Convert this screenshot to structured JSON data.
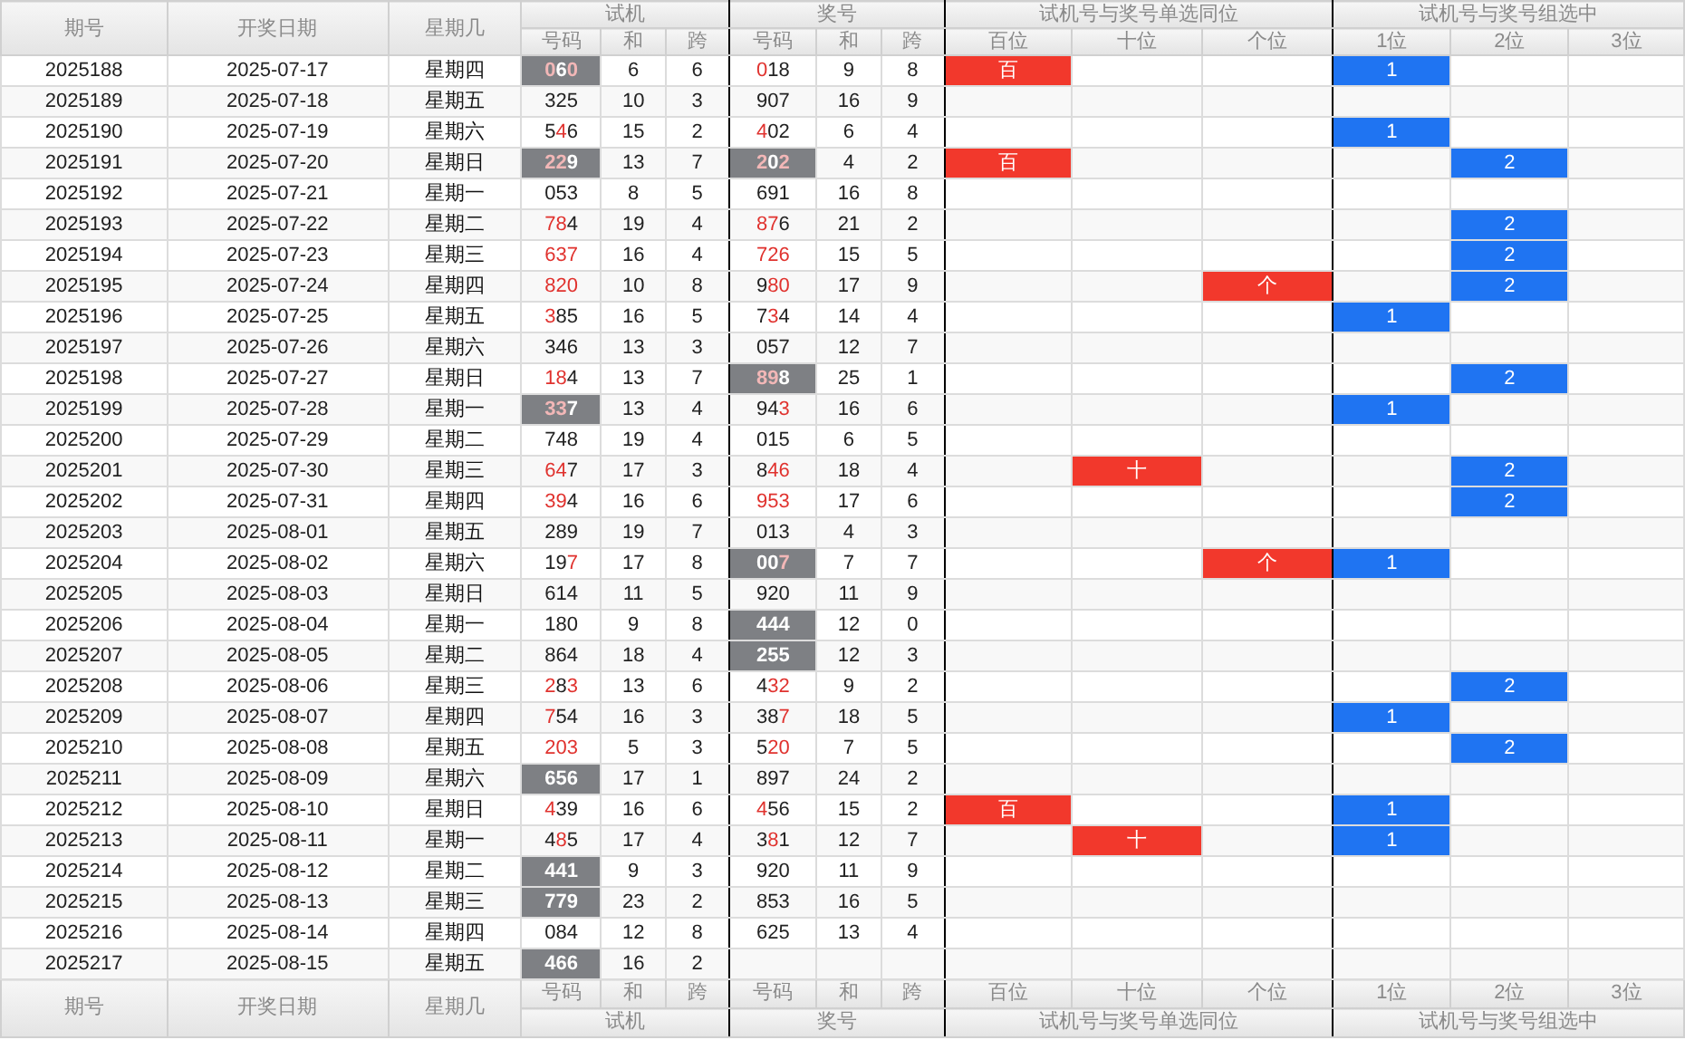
{
  "header": {
    "columns": [
      "期号",
      "开奖日期",
      "星期几"
    ],
    "groups": [
      {
        "title": "试机",
        "sub": [
          "号码",
          "和",
          "跨"
        ]
      },
      {
        "title": "奖号",
        "sub": [
          "号码",
          "和",
          "跨"
        ]
      },
      {
        "title": "试机号与奖号单选同位",
        "sub": [
          "百位",
          "十位",
          "个位"
        ]
      },
      {
        "title": "试机号与奖号组选中",
        "sub": [
          "1位",
          "2位",
          "3位"
        ]
      }
    ]
  },
  "rows": [
    {
      "period": "2025188",
      "date": "2025-07-17",
      "weekday": "星期四",
      "trial": {
        "number": "060",
        "red": [
          true,
          false,
          true
        ],
        "boxed": true
      },
      "trial_sum": "6",
      "trial_span": "6",
      "prize": {
        "number": "018",
        "red": [
          true,
          false,
          false
        ],
        "boxed": false
      },
      "prize_sum": "9",
      "prize_span": "8",
      "single_hit": {
        "hundreds": "百"
      },
      "group_hit": {
        "first": "1"
      }
    },
    {
      "period": "2025189",
      "date": "2025-07-18",
      "weekday": "星期五",
      "trial": {
        "number": "325",
        "red": [
          false,
          false,
          false
        ],
        "boxed": false
      },
      "trial_sum": "10",
      "trial_span": "3",
      "prize": {
        "number": "907",
        "red": [
          false,
          false,
          false
        ],
        "boxed": false
      },
      "prize_sum": "16",
      "prize_span": "9"
    },
    {
      "period": "2025190",
      "date": "2025-07-19",
      "weekday": "星期六",
      "trial": {
        "number": "546",
        "red": [
          false,
          true,
          false
        ],
        "boxed": false
      },
      "trial_sum": "15",
      "trial_span": "2",
      "prize": {
        "number": "402",
        "red": [
          true,
          false,
          false
        ],
        "boxed": false
      },
      "prize_sum": "6",
      "prize_span": "4",
      "group_hit": {
        "first": "1"
      }
    },
    {
      "period": "2025191",
      "date": "2025-07-20",
      "weekday": "星期日",
      "trial": {
        "number": "229",
        "red": [
          true,
          true,
          false
        ],
        "boxed": true
      },
      "trial_sum": "13",
      "trial_span": "7",
      "prize": {
        "number": "202",
        "red": [
          true,
          false,
          true
        ],
        "boxed": true
      },
      "prize_sum": "4",
      "prize_span": "2",
      "single_hit": {
        "hundreds": "百"
      },
      "group_hit": {
        "second": "2"
      }
    },
    {
      "period": "2025192",
      "date": "2025-07-21",
      "weekday": "星期一",
      "trial": {
        "number": "053",
        "red": [
          false,
          false,
          false
        ],
        "boxed": false
      },
      "trial_sum": "8",
      "trial_span": "5",
      "prize": {
        "number": "691",
        "red": [
          false,
          false,
          false
        ],
        "boxed": false
      },
      "prize_sum": "16",
      "prize_span": "8"
    },
    {
      "period": "2025193",
      "date": "2025-07-22",
      "weekday": "星期二",
      "trial": {
        "number": "784",
        "red": [
          true,
          true,
          false
        ],
        "boxed": false
      },
      "trial_sum": "19",
      "trial_span": "4",
      "prize": {
        "number": "876",
        "red": [
          true,
          true,
          false
        ],
        "boxed": false
      },
      "prize_sum": "21",
      "prize_span": "2",
      "group_hit": {
        "second": "2"
      }
    },
    {
      "period": "2025194",
      "date": "2025-07-23",
      "weekday": "星期三",
      "trial": {
        "number": "637",
        "red": [
          true,
          true,
          true
        ],
        "boxed": false
      },
      "trial_sum": "16",
      "trial_span": "4",
      "prize": {
        "number": "726",
        "red": [
          true,
          true,
          true
        ],
        "boxed": false
      },
      "prize_sum": "15",
      "prize_span": "5",
      "group_hit": {
        "second": "2"
      }
    },
    {
      "period": "2025195",
      "date": "2025-07-24",
      "weekday": "星期四",
      "trial": {
        "number": "820",
        "red": [
          true,
          true,
          true
        ],
        "boxed": false
      },
      "trial_sum": "10",
      "trial_span": "8",
      "prize": {
        "number": "980",
        "red": [
          false,
          true,
          true
        ],
        "boxed": false
      },
      "prize_sum": "17",
      "prize_span": "9",
      "single_hit": {
        "units": "个"
      },
      "group_hit": {
        "second": "2"
      }
    },
    {
      "period": "2025196",
      "date": "2025-07-25",
      "weekday": "星期五",
      "trial": {
        "number": "385",
        "red": [
          true,
          false,
          false
        ],
        "boxed": false
      },
      "trial_sum": "16",
      "trial_span": "5",
      "prize": {
        "number": "734",
        "red": [
          false,
          true,
          false
        ],
        "boxed": false
      },
      "prize_sum": "14",
      "prize_span": "4",
      "group_hit": {
        "first": "1"
      }
    },
    {
      "period": "2025197",
      "date": "2025-07-26",
      "weekday": "星期六",
      "trial": {
        "number": "346",
        "red": [
          false,
          false,
          false
        ],
        "boxed": false
      },
      "trial_sum": "13",
      "trial_span": "3",
      "prize": {
        "number": "057",
        "red": [
          false,
          false,
          false
        ],
        "boxed": false
      },
      "prize_sum": "12",
      "prize_span": "7"
    },
    {
      "period": "2025198",
      "date": "2025-07-27",
      "weekday": "星期日",
      "trial": {
        "number": "184",
        "red": [
          true,
          true,
          false
        ],
        "boxed": false
      },
      "trial_sum": "13",
      "trial_span": "7",
      "prize": {
        "number": "898",
        "red": [
          true,
          true,
          false
        ],
        "boxed": true
      },
      "prize_sum": "25",
      "prize_span": "1",
      "group_hit": {
        "second": "2"
      }
    },
    {
      "period": "2025199",
      "date": "2025-07-28",
      "weekday": "星期一",
      "trial": {
        "number": "337",
        "red": [
          true,
          true,
          false
        ],
        "boxed": true
      },
      "trial_sum": "13",
      "trial_span": "4",
      "prize": {
        "number": "943",
        "red": [
          false,
          false,
          true
        ],
        "boxed": false
      },
      "prize_sum": "16",
      "prize_span": "6",
      "group_hit": {
        "first": "1"
      }
    },
    {
      "period": "2025200",
      "date": "2025-07-29",
      "weekday": "星期二",
      "trial": {
        "number": "748",
        "red": [
          false,
          false,
          false
        ],
        "boxed": false
      },
      "trial_sum": "19",
      "trial_span": "4",
      "prize": {
        "number": "015",
        "red": [
          false,
          false,
          false
        ],
        "boxed": false
      },
      "prize_sum": "6",
      "prize_span": "5"
    },
    {
      "period": "2025201",
      "date": "2025-07-30",
      "weekday": "星期三",
      "trial": {
        "number": "647",
        "red": [
          true,
          true,
          false
        ],
        "boxed": false
      },
      "trial_sum": "17",
      "trial_span": "3",
      "prize": {
        "number": "846",
        "red": [
          false,
          true,
          true
        ],
        "boxed": false
      },
      "prize_sum": "18",
      "prize_span": "4",
      "single_hit": {
        "tens": "十"
      },
      "group_hit": {
        "second": "2"
      }
    },
    {
      "period": "2025202",
      "date": "2025-07-31",
      "weekday": "星期四",
      "trial": {
        "number": "394",
        "red": [
          true,
          true,
          false
        ],
        "boxed": false
      },
      "trial_sum": "16",
      "trial_span": "6",
      "prize": {
        "number": "953",
        "red": [
          true,
          true,
          true
        ],
        "boxed": false
      },
      "prize_sum": "17",
      "prize_span": "6",
      "group_hit": {
        "second": "2"
      }
    },
    {
      "period": "2025203",
      "date": "2025-08-01",
      "weekday": "星期五",
      "trial": {
        "number": "289",
        "red": [
          false,
          false,
          false
        ],
        "boxed": false
      },
      "trial_sum": "19",
      "trial_span": "7",
      "prize": {
        "number": "013",
        "red": [
          false,
          false,
          false
        ],
        "boxed": false
      },
      "prize_sum": "4",
      "prize_span": "3"
    },
    {
      "period": "2025204",
      "date": "2025-08-02",
      "weekday": "星期六",
      "trial": {
        "number": "197",
        "red": [
          false,
          false,
          true
        ],
        "boxed": false
      },
      "trial_sum": "17",
      "trial_span": "8",
      "prize": {
        "number": "007",
        "red": [
          false,
          false,
          true
        ],
        "boxed": true
      },
      "prize_sum": "7",
      "prize_span": "7",
      "single_hit": {
        "units": "个"
      },
      "group_hit": {
        "first": "1"
      }
    },
    {
      "period": "2025205",
      "date": "2025-08-03",
      "weekday": "星期日",
      "trial": {
        "number": "614",
        "red": [
          false,
          false,
          false
        ],
        "boxed": false
      },
      "trial_sum": "11",
      "trial_span": "5",
      "prize": {
        "number": "920",
        "red": [
          false,
          false,
          false
        ],
        "boxed": false
      },
      "prize_sum": "11",
      "prize_span": "9"
    },
    {
      "period": "2025206",
      "date": "2025-08-04",
      "weekday": "星期一",
      "trial": {
        "number": "180",
        "red": [
          false,
          false,
          false
        ],
        "boxed": false
      },
      "trial_sum": "9",
      "trial_span": "8",
      "prize": {
        "number": "444",
        "red": [
          false,
          false,
          false
        ],
        "boxed": true
      },
      "prize_sum": "12",
      "prize_span": "0"
    },
    {
      "period": "2025207",
      "date": "2025-08-05",
      "weekday": "星期二",
      "trial": {
        "number": "864",
        "red": [
          false,
          false,
          false
        ],
        "boxed": false
      },
      "trial_sum": "18",
      "trial_span": "4",
      "prize": {
        "number": "255",
        "red": [
          false,
          false,
          false
        ],
        "boxed": true
      },
      "prize_sum": "12",
      "prize_span": "3"
    },
    {
      "period": "2025208",
      "date": "2025-08-06",
      "weekday": "星期三",
      "trial": {
        "number": "283",
        "red": [
          true,
          false,
          true
        ],
        "boxed": false
      },
      "trial_sum": "13",
      "trial_span": "6",
      "prize": {
        "number": "432",
        "red": [
          false,
          true,
          true
        ],
        "boxed": false
      },
      "prize_sum": "9",
      "prize_span": "2",
      "group_hit": {
        "second": "2"
      }
    },
    {
      "period": "2025209",
      "date": "2025-08-07",
      "weekday": "星期四",
      "trial": {
        "number": "754",
        "red": [
          true,
          false,
          false
        ],
        "boxed": false
      },
      "trial_sum": "16",
      "trial_span": "3",
      "prize": {
        "number": "387",
        "red": [
          false,
          false,
          true
        ],
        "boxed": false
      },
      "prize_sum": "18",
      "prize_span": "5",
      "group_hit": {
        "first": "1"
      }
    },
    {
      "period": "2025210",
      "date": "2025-08-08",
      "weekday": "星期五",
      "trial": {
        "number": "203",
        "red": [
          true,
          true,
          true
        ],
        "boxed": false
      },
      "trial_sum": "5",
      "trial_span": "3",
      "prize": {
        "number": "520",
        "red": [
          false,
          true,
          true
        ],
        "boxed": false
      },
      "prize_sum": "7",
      "prize_span": "5",
      "group_hit": {
        "second": "2"
      }
    },
    {
      "period": "2025211",
      "date": "2025-08-09",
      "weekday": "星期六",
      "trial": {
        "number": "656",
        "red": [
          false,
          false,
          false
        ],
        "boxed": true
      },
      "trial_sum": "17",
      "trial_span": "1",
      "prize": {
        "number": "897",
        "red": [
          false,
          false,
          false
        ],
        "boxed": false
      },
      "prize_sum": "24",
      "prize_span": "2"
    },
    {
      "period": "2025212",
      "date": "2025-08-10",
      "weekday": "星期日",
      "trial": {
        "number": "439",
        "red": [
          true,
          false,
          false
        ],
        "boxed": false
      },
      "trial_sum": "16",
      "trial_span": "6",
      "prize": {
        "number": "456",
        "red": [
          true,
          false,
          false
        ],
        "boxed": false
      },
      "prize_sum": "15",
      "prize_span": "2",
      "single_hit": {
        "hundreds": "百"
      },
      "group_hit": {
        "first": "1"
      }
    },
    {
      "period": "2025213",
      "date": "2025-08-11",
      "weekday": "星期一",
      "trial": {
        "number": "485",
        "red": [
          false,
          true,
          false
        ],
        "boxed": false
      },
      "trial_sum": "17",
      "trial_span": "4",
      "prize": {
        "number": "381",
        "red": [
          false,
          true,
          false
        ],
        "boxed": false
      },
      "prize_sum": "12",
      "prize_span": "7",
      "single_hit": {
        "tens": "十"
      },
      "group_hit": {
        "first": "1"
      }
    },
    {
      "period": "2025214",
      "date": "2025-08-12",
      "weekday": "星期二",
      "trial": {
        "number": "441",
        "red": [
          false,
          false,
          false
        ],
        "boxed": true
      },
      "trial_sum": "9",
      "trial_span": "3",
      "prize": {
        "number": "920",
        "red": [
          false,
          false,
          false
        ],
        "boxed": false
      },
      "prize_sum": "11",
      "prize_span": "9"
    },
    {
      "period": "2025215",
      "date": "2025-08-13",
      "weekday": "星期三",
      "trial": {
        "number": "779",
        "red": [
          false,
          false,
          false
        ],
        "boxed": true
      },
      "trial_sum": "23",
      "trial_span": "2",
      "prize": {
        "number": "853",
        "red": [
          false,
          false,
          false
        ],
        "boxed": false
      },
      "prize_sum": "16",
      "prize_span": "5"
    },
    {
      "period": "2025216",
      "date": "2025-08-14",
      "weekday": "星期四",
      "trial": {
        "number": "084",
        "red": [
          false,
          false,
          false
        ],
        "boxed": false
      },
      "trial_sum": "12",
      "trial_span": "8",
      "prize": {
        "number": "625",
        "red": [
          false,
          false,
          false
        ],
        "boxed": false
      },
      "prize_sum": "13",
      "prize_span": "4"
    },
    {
      "period": "2025217",
      "date": "2025-08-15",
      "weekday": "星期五",
      "trial": {
        "number": "466",
        "red": [
          false,
          false,
          false
        ],
        "boxed": true
      },
      "trial_sum": "16",
      "trial_span": "2"
    }
  ],
  "footer": {
    "columns": [
      "期号",
      "开奖日期",
      "星期几"
    ],
    "groups": [
      {
        "title": "试机",
        "sub": [
          "号码",
          "和",
          "跨"
        ]
      },
      {
        "title": "奖号",
        "sub": [
          "号码",
          "和",
          "跨"
        ]
      },
      {
        "title": "试机号与奖号单选同位",
        "sub": [
          "百位",
          "十位",
          "个位"
        ]
      },
      {
        "title": "试机号与奖号组选中",
        "sub": [
          "1位",
          "2位",
          "3位"
        ]
      }
    ]
  }
}
